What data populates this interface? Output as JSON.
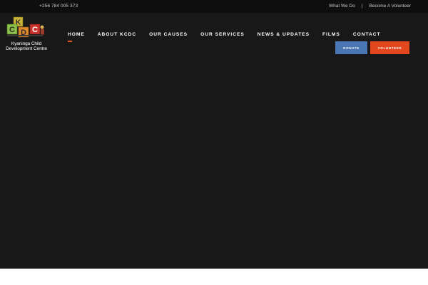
{
  "colors": {
    "topbar_bg": "#0e0e0e",
    "hero_bg": "#181818",
    "accent": "#e85528",
    "donate_bg": "#4a76b3",
    "volunteer_bg": "#e2471d"
  },
  "topbar": {
    "phone": "+256 784 005 373",
    "links": [
      "What We Do",
      "Become A Volunteer"
    ],
    "separator": "|"
  },
  "logo": {
    "blocks": [
      "K",
      "C",
      "D",
      "C"
    ],
    "caption_line1": "Kyaninga Child",
    "caption_line2": "Development Centre"
  },
  "nav": {
    "items": [
      "HOME",
      "ABOUT KCDC",
      "OUR CAUSES",
      "OUR SERVICES",
      "NEWS & UPDATES",
      "FILMS",
      "CONTACT"
    ],
    "active": "HOME"
  },
  "buttons": {
    "donate": "DONATE",
    "volunteer": "VOLUNTEER"
  }
}
